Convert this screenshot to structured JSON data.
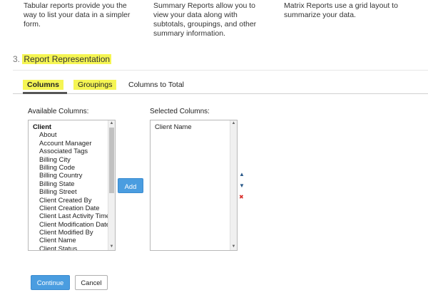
{
  "descriptions": {
    "tabular": "Tabular reports provide you the way to list your data in a simpler form.",
    "summary": "Summary Reports allow you to view your data along with subtotals, groupings, and other summary information.",
    "matrix": "Matrix Reports use a grid layout to summarize your data."
  },
  "section": {
    "number": "3.",
    "title": "Report Representation"
  },
  "tabs": {
    "columns": "Columns",
    "groupings": "Groupings",
    "columns_to_total": "Columns to Total"
  },
  "available": {
    "label": "Available Columns:",
    "group": "Client",
    "items": [
      "About",
      "Account Manager",
      "Associated Tags",
      "Billing City",
      "Billing Code",
      "Billing Country",
      "Billing State",
      "Billing Street",
      "Client Created By",
      "Client Creation Date",
      "Client Last Activity Time",
      "Client Modification Date",
      "Client Modified By",
      "Client Name",
      "Client Status"
    ]
  },
  "selected": {
    "label": "Selected Columns:",
    "items": [
      "Client Name"
    ]
  },
  "buttons": {
    "add": "Add",
    "continue": "Continue",
    "cancel": "Cancel"
  },
  "icons": {
    "move_up": "▲",
    "move_down": "▼",
    "remove": "✖"
  },
  "colors": {
    "highlight": "#f5f553",
    "primary": "#4a9de0",
    "remove": "#d9302c",
    "arrow": "#2a5a8a"
  }
}
